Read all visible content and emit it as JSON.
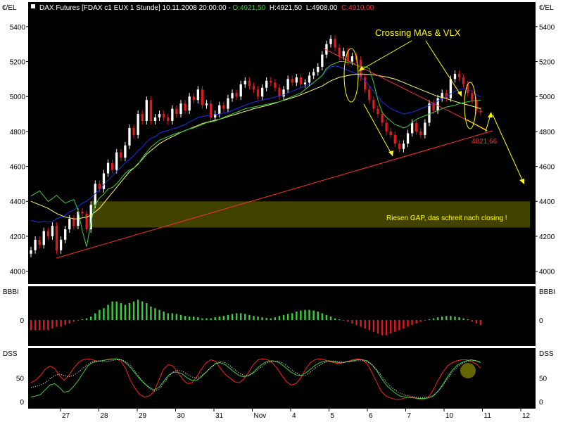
{
  "header": {
    "symbol": "DAX Futures [FDAX c1 EUX  1 Stunde] 10.11.2008 20:00:00",
    "open": "O:4921,50",
    "high": "H:4921,50",
    "low": "L:4908,00",
    "close": "C:4910,00"
  },
  "panels": {
    "price": {
      "unit": "€/EL",
      "yticks": [
        "4000",
        "4200",
        "4400",
        "4600",
        "4800",
        "5000",
        "5200",
        "5400"
      ]
    },
    "bbbi": {
      "label": "BBBI",
      "yticks": [
        "0"
      ]
    },
    "dss": {
      "label": "DSS",
      "yticks": [
        "0",
        "50"
      ]
    }
  },
  "xticks": [
    "27",
    "28",
    "29",
    "30",
    "31",
    "Nov",
    "4",
    "5",
    "6",
    "7",
    "10",
    "11",
    "12"
  ],
  "annotations": {
    "crossing": "Crossing MAs & VLX",
    "gap": "Riesen GAP, das schreit nach closing !",
    "level": "4821,66"
  },
  "colors": {
    "background": "#000000",
    "bull": "#ffffff",
    "bear": "#e0191d",
    "ma_blue": "#1c2fe6",
    "ma_yellow": "#ffff66",
    "env_green": "#3ccc3c",
    "trend_red": "#ff3030",
    "annot_yellow": "#ffff00"
  },
  "chart_data": [
    {
      "type": "candlestick",
      "panel": "price",
      "ylim": [
        3950,
        5480
      ],
      "x_categories": [
        "27",
        "28",
        "29",
        "30",
        "31",
        "Nov",
        "4",
        "5",
        "6",
        "7",
        "10",
        "11",
        "12"
      ],
      "close": [
        4120,
        4180,
        4150,
        4230,
        4200,
        4260,
        4120,
        4180,
        4240,
        4300,
        4260,
        4340,
        4330,
        4240,
        4380,
        4500,
        4470,
        4560,
        4620,
        4580,
        4680,
        4650,
        4720,
        4820,
        4780,
        4900,
        4860,
        4980,
        4860,
        4880,
        4900,
        4880,
        4860,
        4930,
        4900,
        4960,
        4920,
        5000,
        4980,
        5040,
        4950,
        4960,
        4880,
        4900,
        4950,
        4930,
        4990,
        5020,
        5000,
        5070,
        5090,
        5060,
        5040,
        5000,
        5050,
        5090,
        5080,
        5050,
        5000,
        5040,
        5100,
        5080,
        5110,
        5070,
        5080,
        5120,
        5140,
        5170,
        5240,
        5300,
        5330,
        5280,
        5230,
        5260,
        5200,
        5230,
        5210,
        5110,
        5040,
        4980,
        4930,
        4900,
        4850,
        4800,
        4780,
        4730,
        4700,
        4730,
        4790,
        4850,
        4800,
        4780,
        4850,
        4960,
        4920,
        4990,
        5020,
        4990,
        5100,
        5130,
        5110,
        5070,
        5020,
        4980,
        4920,
        4910
      ],
      "series": [
        {
          "name": "",
          "color": "#1c2fe6",
          "values": [
            4290,
            4285,
            4280,
            4285,
            4280,
            4285,
            4300,
            4310,
            4320,
            4340,
            4350,
            4370,
            4390,
            4400,
            4420,
            4445,
            4465,
            4495,
            4520,
            4545,
            4570,
            4595,
            4620,
            4640,
            4660,
            4690,
            4710,
            4740,
            4760,
            4770,
            4790,
            4800,
            4805,
            4815,
            4820,
            4830,
            4840,
            4855,
            4865,
            4880,
            4885,
            4890,
            4893,
            4896,
            4900,
            4905,
            4910,
            4920,
            4930,
            4940,
            4950,
            4960,
            4967,
            4973,
            4980,
            4985,
            4990,
            4997,
            5003,
            5010,
            5020,
            5030,
            5040,
            5050,
            5060,
            5070,
            5080,
            5100,
            5120,
            5150,
            5170,
            5175,
            5170,
            5160,
            5150,
            5140,
            5130,
            5110,
            5090,
            5060,
            5030,
            5000,
            4970,
            4950,
            4930,
            4920,
            4910,
            4900,
            4905,
            4910,
            4920,
            4930,
            4940,
            4950,
            4960,
            4975,
            4990,
            5000,
            5015,
            5030,
            5040,
            5045,
            5040,
            5030,
            5010,
            5000
          ]
        },
        {
          "name": "",
          "color": "#ffff66",
          "values": [
            4400,
            4390,
            4380,
            4370,
            4360,
            4345,
            4330,
            4320,
            4310,
            4305,
            4300,
            4300,
            4305,
            4310,
            4320,
            4340,
            4360,
            4390,
            4420,
            4450,
            4480,
            4510,
            4540,
            4570,
            4590,
            4615,
            4640,
            4670,
            4690,
            4710,
            4730,
            4745,
            4758,
            4770,
            4782,
            4795,
            4805,
            4815,
            4825,
            4835,
            4845,
            4852,
            4858,
            4864,
            4870,
            4877,
            4885,
            4892,
            4900,
            4908,
            4915,
            4922,
            4930,
            4936,
            4942,
            4948,
            4955,
            4962,
            4970,
            4978,
            4985,
            4993,
            5000,
            5010,
            5020,
            5030,
            5040,
            5050,
            5060,
            5075,
            5090,
            5100,
            5110,
            5115,
            5120,
            5125,
            5128,
            5129,
            5128,
            5126,
            5124,
            5120,
            5116,
            5112,
            5106,
            5100,
            5090,
            5080,
            5070,
            5060,
            5050,
            5040,
            5030,
            5020,
            5010,
            5000,
            4995,
            4988,
            4980,
            4972,
            4965,
            4958,
            4952,
            4945,
            4938,
            4930
          ]
        },
        {
          "name": "",
          "color": "#3ccc3c",
          "values": [
            4430,
            4445,
            4460,
            4430,
            4400,
            4415,
            4435,
            4410,
            4390,
            4400,
            4410,
            4350,
            4230,
            4140,
            4280,
            4380,
            4420,
            4440,
            4470,
            4480,
            4500,
            4530,
            4560,
            4580,
            4590,
            4610,
            4650,
            4680,
            4710,
            4730,
            4750,
            4760,
            4770,
            4780,
            4790,
            4795,
            4805,
            4815,
            4820,
            4830,
            4840,
            4850,
            4855,
            4860,
            4870,
            4880,
            4890,
            4900,
            4910,
            4920,
            4930,
            4935,
            4940,
            4945,
            4950,
            4955,
            4960,
            4965,
            4970,
            4980,
            4990,
            5000,
            5010,
            5020,
            5040,
            5060,
            5080,
            5100,
            5120,
            5160,
            5180,
            5190,
            5200,
            5200,
            5195,
            5190,
            5180,
            5170,
            5170,
            5160,
            5080,
            4980,
            4910,
            4880,
            4860,
            4840,
            4830,
            4820,
            4830,
            4850,
            4870,
            4880,
            4890,
            4900,
            4910,
            4920,
            4930,
            4940,
            4945,
            4950,
            4960,
            4965,
            4970,
            4975,
            4975,
            4980
          ]
        }
      ]
    },
    {
      "type": "bar",
      "panel": "bbbi",
      "ylim": [
        -1,
        1
      ],
      "values": [
        -0.3,
        -0.3,
        -0.3,
        -0.3,
        -0.3,
        -0.25,
        -0.2,
        -0.2,
        -0.15,
        -0.1,
        -0.05,
        -0.02,
        0.02,
        0.05,
        0.1,
        0.2,
        0.3,
        0.35,
        0.45,
        0.55,
        0.55,
        0.5,
        0.45,
        0.5,
        0.55,
        0.6,
        0.55,
        0.5,
        0.4,
        0.35,
        0.3,
        0.25,
        0.2,
        0.2,
        0.18,
        0.15,
        0.12,
        0.1,
        0.1,
        0.08,
        0.05,
        0.05,
        0.05,
        0.08,
        0.1,
        0.12,
        0.15,
        0.18,
        0.2,
        0.2,
        0.18,
        0.15,
        0.12,
        0.1,
        0.08,
        0.06,
        0.05,
        0.08,
        0.12,
        0.15,
        0.18,
        0.2,
        0.25,
        0.28,
        0.3,
        0.3,
        0.28,
        0.25,
        0.2,
        0.15,
        0.1,
        0.05,
        0.02,
        -0.02,
        -0.05,
        -0.1,
        -0.15,
        -0.2,
        -0.25,
        -0.3,
        -0.35,
        -0.4,
        -0.45,
        -0.45,
        -0.4,
        -0.35,
        -0.3,
        -0.25,
        -0.2,
        -0.15,
        -0.1,
        -0.05,
        -0.02,
        0.02,
        0.05,
        0.08,
        0.1,
        0.12,
        0.12,
        0.1,
        0.08,
        0.05,
        0.02,
        -0.05,
        -0.1,
        -0.15
      ]
    },
    {
      "type": "line",
      "panel": "dss",
      "ylim": [
        -10,
        105
      ],
      "series": [
        {
          "name": "",
          "color": "#ff2020",
          "values": [
            40,
            45,
            55,
            68,
            75,
            70,
            55,
            45,
            55,
            70,
            82,
            88,
            90,
            88,
            85,
            86,
            88,
            90,
            90,
            85,
            70,
            45,
            28,
            15,
            10,
            12,
            22,
            45,
            68,
            78,
            75,
            62,
            48,
            38,
            40,
            52,
            68,
            82,
            88,
            85,
            70,
            58,
            50,
            42,
            40,
            48,
            62,
            78,
            88,
            90,
            88,
            82,
            70,
            55,
            42,
            35,
            38,
            50,
            68,
            82,
            88,
            90,
            88,
            85,
            82,
            80,
            82,
            85,
            88,
            90,
            88,
            80,
            62,
            42,
            22,
            12,
            8,
            5,
            5,
            8,
            10,
            8,
            5,
            5,
            10,
            25,
            45,
            62,
            75,
            82,
            86,
            88,
            88,
            85,
            80,
            70
          ]
        },
        {
          "name": "",
          "color": "#3ccc3c",
          "values": [
            10,
            12,
            15,
            25,
            35,
            38,
            30,
            20,
            22,
            32,
            45,
            60,
            75,
            82,
            85,
            86,
            88,
            89,
            90,
            88,
            82,
            72,
            60,
            48,
            38,
            30,
            25,
            30,
            42,
            55,
            62,
            62,
            58,
            50,
            45,
            45,
            52,
            62,
            72,
            80,
            82,
            78,
            70,
            62,
            55,
            52,
            55,
            62,
            72,
            80,
            85,
            86,
            84,
            78,
            70,
            62,
            56,
            55,
            60,
            68,
            76,
            82,
            85,
            86,
            84,
            82,
            82,
            84,
            86,
            88,
            88,
            86,
            78,
            66,
            50,
            36,
            26,
            18,
            12,
            10,
            9,
            8,
            7,
            7,
            8,
            12,
            22,
            36,
            52,
            66,
            76,
            82,
            86,
            88,
            86,
            82
          ]
        },
        {
          "name": "",
          "color": "#ffffff",
          "dashed": true,
          "values": [
            30,
            32,
            35,
            40,
            48,
            55,
            58,
            55,
            52,
            55,
            62,
            70,
            78,
            84,
            86,
            85,
            84,
            86,
            88,
            88,
            84,
            76,
            64,
            50,
            38,
            28,
            22,
            26,
            38,
            52,
            62,
            66,
            64,
            58,
            52,
            50,
            54,
            62,
            72,
            80,
            84,
            82,
            76,
            68,
            60,
            55,
            55,
            60,
            68,
            76,
            82,
            85,
            85,
            82,
            76,
            68,
            60,
            55,
            56,
            62,
            70,
            77,
            82,
            85,
            85,
            84,
            83,
            84,
            85,
            86,
            86,
            84,
            78,
            68,
            55,
            42,
            32,
            24,
            18,
            14,
            12,
            10,
            9,
            9,
            10,
            14,
            22,
            34,
            48,
            62,
            72,
            80,
            84,
            86,
            86,
            84
          ]
        }
      ]
    }
  ]
}
